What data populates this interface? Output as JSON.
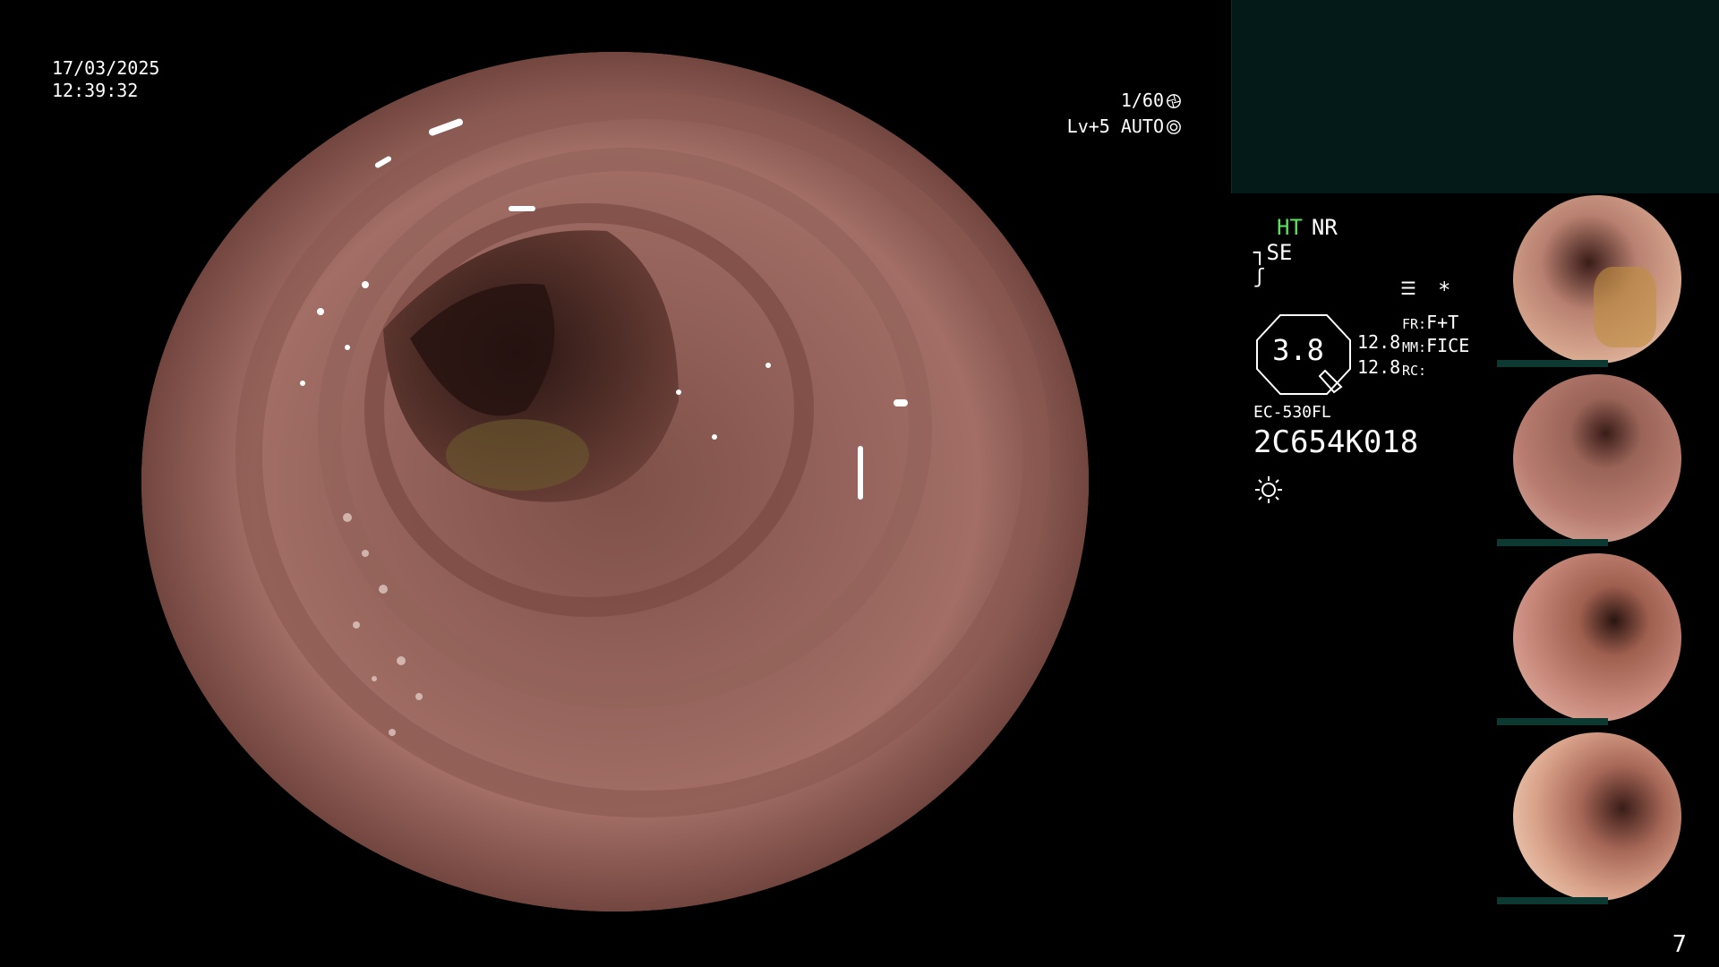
{
  "datetime": {
    "date": "17/03/2025",
    "time": "12:39:32"
  },
  "camera": {
    "shutter": "1/60",
    "level": "Lv+5",
    "mode": "AUTO",
    "shutter_icon": "aperture-icon",
    "mode_icon": "iris-icon"
  },
  "status": {
    "ht": "HT",
    "nr": "NR",
    "se": "SE",
    "se_icon": "structure-enhance-icon",
    "color_icon": "color-enhance-icon",
    "worksheet_icon": "worksheet-icon",
    "star": "*"
  },
  "gauge": {
    "value": "3.8"
  },
  "scales": {
    "first": "12.8",
    "second": "12.8"
  },
  "modes": {
    "fr_label": "FR:",
    "fr_value": "F+T",
    "mm_label": "MM:",
    "mm_value": "FICE",
    "rc_label": "RC:"
  },
  "scope": {
    "model": "EC-530FL",
    "serial": "2C654K018"
  },
  "light_icon": "sun-icon",
  "thumbnails": [
    {
      "name": "capture-1"
    },
    {
      "name": "capture-2"
    },
    {
      "name": "capture-3"
    },
    {
      "name": "capture-4"
    }
  ],
  "page_number": "7",
  "colors": {
    "ht_green": "#59e35a",
    "teal_panel": "#031a18",
    "thumb_bar": "#0c3a33"
  }
}
